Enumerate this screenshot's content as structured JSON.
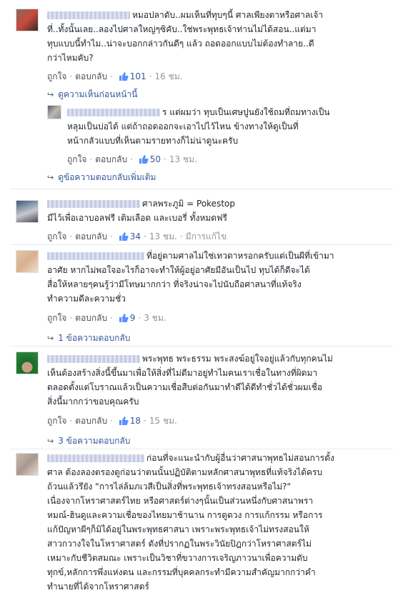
{
  "labels": {
    "like": "ถูกใจ",
    "reply": "ตอบกลับ",
    "edited": "มีการแก้ไข",
    "sep": "·"
  },
  "comments": [
    {
      "avatar_colors": [
        "#8a6a5a",
        "#c94a3a",
        "#3a2a2a"
      ],
      "name_suffix": "หมอปลาดับ..",
      "lines": [
        "ผมเห็นที่ทุบๆนี้ ศาลเพียงตาหรือศาลเจ้า",
        "ที่..ทั้งนั้นเลย..ลองไปศาลใหญ่ๆซิคับ..ใช่พระพุทธเจ้าท่านไม่ได้สอน..แต่มา",
        "ทุบแบบนี้ทำไม..น่าจะบอกกล่าวกันดีๆ แล้ว ถอดออกแบบไม่ต้องทำลาย..ดี",
        "กว่าไหมคับ?"
      ],
      "likes": "101",
      "time": "16 ชม.",
      "prev_link": "ดูความเห็นก่อนหน้านี้",
      "reply": {
        "avatar_colors": [
          "#5a5a6a",
          "#bfb8b0",
          "#8a8a9a"
        ],
        "name_suffix": "ร",
        "lines": [
          "แต่ผมว่า ทุบเป็นเศษปูนยังใช้ถมที่ถมทางเป็น",
          "หลุมเป็นบ่อได้ แต่ถ้าถอดออกจะเอาไปไว้ไหน ข้างทางให้ดูเป็นที่",
          "หน้ากลัวแบบที่เห็นตามรายทางก็ไม่น่าดูนะครับ"
        ],
        "likes": "50",
        "time": "13 ชม."
      },
      "more_link": "ดูข้อความตอบกลับเพิ่มเติม"
    },
    {
      "avatar_colors": [
        "#3a5a7a",
        "#c8c8d0",
        "#4a4a5a"
      ],
      "name_suffix": "ศาลพระภูมิ = Pokestop",
      "lines": [
        "",
        "มีไว้เพื่อเอาบอลฟรี เติมเลือด และเบอรี่ ทั้งหมดฟรี"
      ],
      "likes": "34",
      "time": "13 ชม.",
      "edited": true
    },
    {
      "avatar_colors": [
        "#e0c8a8",
        "#d8b090",
        "#f0e0d0"
      ],
      "name_suffix": "ที่อยู่ตามศาลไม่ใช่เทวดาหรอกครับแต่เป็นผีที่เข้ามา",
      "lines": [
        "อาศัย หากไม่พอใจอะไรก็อาจะทำให้ผู้อยู่อาศัยมีอันเป็นไป ทุบได้ก็ดีจะได้",
        "สื่อให้หลายๆคนรู้ว่ามีโทษมากกว่า ที่จริงน่าจะไปนับถือศาสนาที่แท้จริง",
        "ทำความดีละความชั่ว"
      ],
      "likes": "9",
      "time": "3 ชม.",
      "replies_link": "1 ข้อความตอบกลับ"
    },
    {
      "avatar_colors": [
        "#2a8a3a",
        "#1a6a2a",
        "#c8a080"
      ],
      "name_suffix": "พระพุทธ พระธรรม พระสงฆ์อยู่ใจอยู่แล้วกับทุกคนไม่",
      "lines": [
        "เห็นต้องสร้างสิ่งนี้ขึ้นมาเพื่อให้สิ่งที่ไม่ดีมาอยู่ทำไมคนเราเชื่อในทางที่ผิดมา",
        "ตลอดตั้งแต่โบราณแล้วเป็นความเชื่อสืบต่อกันมาทำดีได้ดีทำชั่วได้ชั่วผมเชื่อ",
        "สิ่งนี้มากกว่าขอบคุณครับ"
      ],
      "likes": "18",
      "time": "15 ชม.",
      "replies_link": "3 ข้อความตอบกลับ"
    },
    {
      "avatar_colors": [
        "#c8b8b0",
        "#a89890",
        "#e8d8d0"
      ],
      "name_suffix": "ก่อนที่จะแนะนำกับผู้อื่นว่าศาสนาพุทธไม่สอนการตั้ง",
      "lines": [
        "ศาล ต้องลองตรองดูก่อนว่าตนนั้นปฏิบัติตามหลักศาสนาพุทธที่แท้จริงได้ครบ",
        "ถ้วนแล้วรึยัง \"การไล่ล้มภเวสีเป็นสิ่งที่พระพุทธเจ้าทรงสอนหรือไม่?\"",
        "เนื่องจากโหราศาสตร์ไทย หรือศาสตร์ต่างๆนั้นเป็นส่วนหนึ่งกับศาสนาพรา",
        "หมณ์-ฮินดูและความเชื่อของไทยมาช้านาน การดูดวง การแก้กรรม หรือการ",
        "แก้ปัญหาผีๆก็มิได้อยู่ในพระพุทธศาสนา เพราะพระพุทธเจ้าไม่ทรงสอนให้",
        "สาวกวางใจในโหราศาสตร์ ดังที่ปรากฏในพระวินัยปิฎกว่าโหราศาสตร์ไม่",
        "เหมาะกับชีวิตสมณะ เพราะเป็นวิชาที่ขวางการเจริญภาวนาเพื่อความดับ",
        "ทุกข์,หลักการพึ่งแห่งตน และกรรมที่บุคคลกระทำมีความสำคัญมากกว่าคำ",
        "ทำนายที่ได้จากโหราศาสตร์"
      ]
    }
  ]
}
